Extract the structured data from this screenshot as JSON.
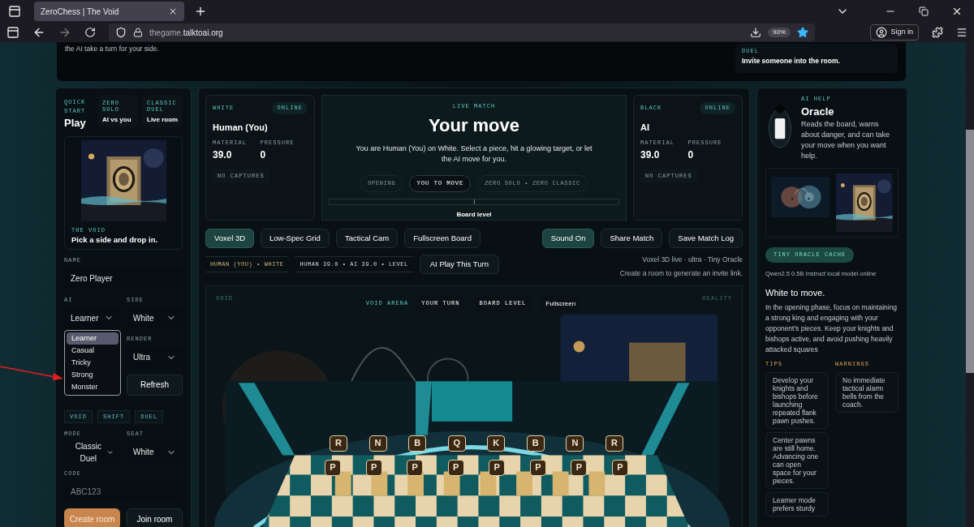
{
  "browser": {
    "tab_title": "ZeroChess | The Void",
    "url_prefix": "thegame.",
    "url_domain": "talktoai.org",
    "zoom": "90%",
    "sign_in": "Sign in"
  },
  "top_card": {
    "text": "the AI take a turn for your side.",
    "duel_label": "DUEL",
    "duel_text": "Invite someone into the room."
  },
  "quick_start": {
    "label": "QUICK START",
    "title": "Play",
    "modes": [
      {
        "label": "ZERO SOLO",
        "title": "AI vs you"
      },
      {
        "label": "CLASSIC DUEL",
        "title": "Live room"
      }
    ]
  },
  "void_card": {
    "label": "THE VOID",
    "title": "Pick a side and drop in."
  },
  "form": {
    "name_label": "NAME",
    "name_value": "Zero Player",
    "ai_label": "AI",
    "ai_value": "Learner",
    "side_label": "SIDE",
    "side_value": "White",
    "render_label": "RENDER",
    "render_value": "Ultra",
    "refresh": "Refresh",
    "ai_options": [
      {
        "label": "Learner",
        "selected": true
      },
      {
        "label": "Casual",
        "selected": false
      },
      {
        "label": "Tricky",
        "selected": false
      },
      {
        "label": "Strong",
        "selected": false
      },
      {
        "label": "Monster",
        "selected": false
      }
    ],
    "tags": [
      "VOID",
      "SHIFT",
      "DUEL"
    ],
    "mode_label": "MODE",
    "mode_value": "Classic Duel",
    "seat_label": "SEAT",
    "seat_value": "White",
    "code_label": "CODE",
    "code_placeholder": "ABC123",
    "create": "Create room",
    "join": "Join room"
  },
  "players": [
    {
      "side": "WHITE",
      "status": "ONLINE",
      "name": "Human (You)",
      "material_label": "MATERIAL",
      "material": "39.0",
      "pressure_label": "PRESSURE",
      "pressure": "0",
      "captures": "NO CAPTURES"
    },
    {
      "side": "BLACK",
      "status": "ONLINE",
      "name": "AI",
      "material_label": "MATERIAL",
      "material": "39.0",
      "pressure_label": "PRESSURE",
      "pressure": "0",
      "captures": "NO CAPTURES"
    }
  ],
  "live": {
    "label": "LIVE MATCH",
    "title": "Your move",
    "description": "You are Human (You) on White. Select a piece, hit a glowing target, or let the AI move for you.",
    "chips": [
      {
        "label": "OPENING",
        "selected": false
      },
      {
        "label": "YOU TO MOVE",
        "selected": true
      },
      {
        "label": "ZERO SOLO • ZERO CLASSIC",
        "selected": false
      }
    ],
    "board_level": {
      "level": 0.5,
      "label": "Board level"
    }
  },
  "view_buttons": [
    {
      "label": "Voxel 3D",
      "selected": true
    },
    {
      "label": "Low-Spec Grid",
      "selected": false
    },
    {
      "label": "Tactical Cam",
      "selected": false
    },
    {
      "label": "Fullscreen Board",
      "selected": false
    }
  ],
  "action_buttons": [
    {
      "label": "Sound On",
      "selected": true
    },
    {
      "label": "Share Match",
      "selected": false
    },
    {
      "label": "Save Match Log",
      "selected": false
    }
  ],
  "status_chips": [
    {
      "label": "HUMAN (YOU) • WHITE",
      "kind": "player"
    },
    {
      "label": "HUMAN 39.0 • AI 39.0 • LEVEL",
      "kind": "score"
    }
  ],
  "ai_play": "AI Play This Turn",
  "status_info": [
    "Voxel 3D live · ultra · Tiny Oracle",
    "Create a room to generate an invite link."
  ],
  "arena": {
    "left_label": "VOID",
    "right_label": "REALITY",
    "chips": [
      {
        "kind": "label",
        "label": "VOID ARENA"
      },
      {
        "kind": "chip",
        "label": "YOUR TURN"
      },
      {
        "kind": "chip",
        "label": "BOARD LEVEL"
      },
      {
        "kind": "button",
        "label": "Fullscreen"
      }
    ],
    "back_rank": [
      "R",
      "N",
      "B",
      "Q",
      "K",
      "B",
      "N",
      "R"
    ],
    "pawns": [
      "P",
      "P",
      "P",
      "P",
      "P",
      "P",
      "P",
      "P"
    ]
  },
  "oracle": {
    "label": "AI HELP",
    "title": "Oracle",
    "description": "Reads the board, warns about danger, and can take your move when you want help.",
    "cache_badge": "TINY ORACLE CACHE",
    "model": "Qwen2.5 0.5B Instruct local model online",
    "heading": "White to move.",
    "advice": "In the opening phase, focus on maintaining a strong king and engaging with your opponent's pieces. Keep your knights and bishops active, and avoid pushing heavily attacked squares",
    "tips_label": "TIPS",
    "warnings_label": "WARNINGS",
    "tips": [
      "Develop your knights and bishops before launching repeated flank pawn pushes.",
      "Center pawns are still home. Advancing one can open space for your pieces.",
      "Learner mode prefers sturdy"
    ],
    "warnings": [
      "No immediate tactical alarm bells from the coach."
    ]
  }
}
